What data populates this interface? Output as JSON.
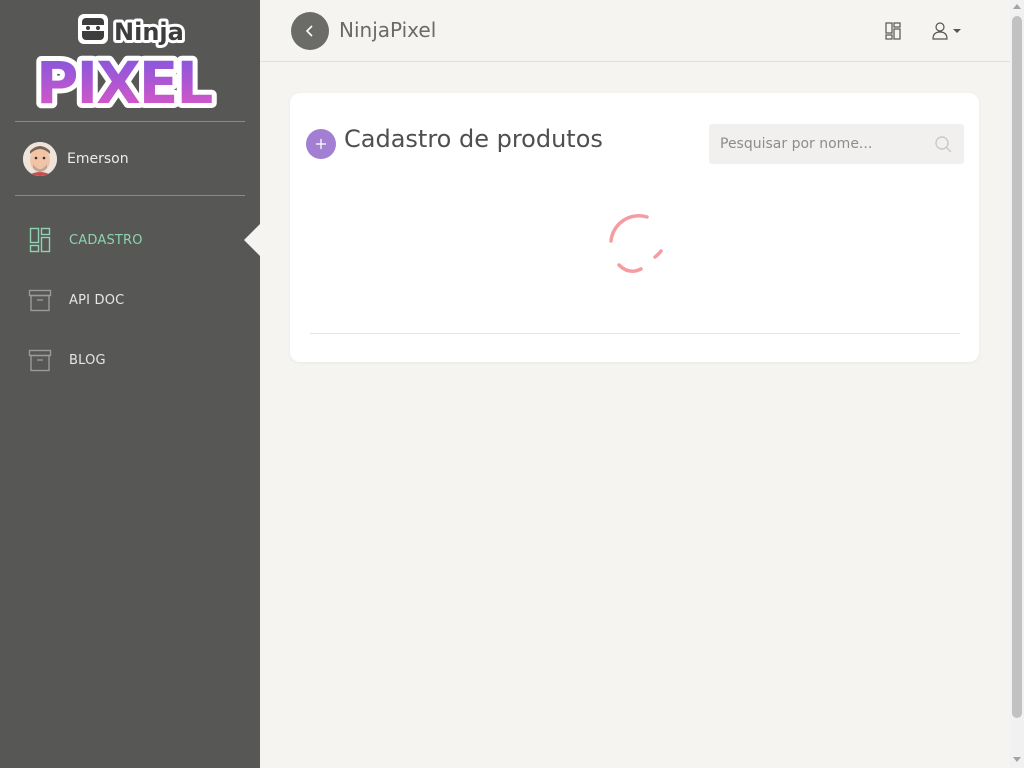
{
  "brand": {
    "logo_top": "Ninja",
    "logo_bottom": "PIXEL",
    "app_title": "NinjaPixel",
    "colors": {
      "sidebar": "#575755",
      "accent_active": "#8fd3b2",
      "add_button": "#a27fd3",
      "spinner": "#f59ca0"
    }
  },
  "user": {
    "name": "Emerson",
    "avatar_icon": "user-avatar"
  },
  "sidebar": {
    "items": [
      {
        "label": "CADASTRO",
        "icon": "dashboard-grid-icon",
        "active": true
      },
      {
        "label": "API DOC",
        "icon": "archive-box-icon",
        "active": false
      },
      {
        "label": "BLOG",
        "icon": "archive-box-icon",
        "active": false
      }
    ]
  },
  "topbar": {
    "back_icon": "chevron-left-icon",
    "grid_icon": "dashboard-grid-icon",
    "user_icon": "user-icon"
  },
  "card": {
    "title": "Cadastro de produtos",
    "add_icon": "plus-icon",
    "search_placeholder": "Pesquisar por nome...",
    "search_value": "",
    "loading": true
  }
}
